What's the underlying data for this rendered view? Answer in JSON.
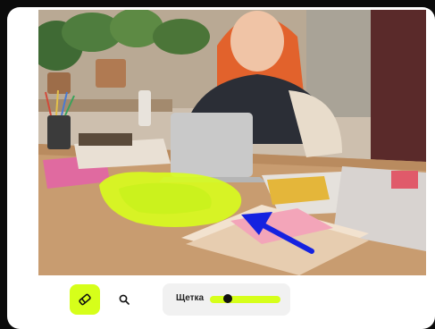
{
  "editor": {
    "image": {
      "alt": "",
      "mask_color": "#d8ff1a",
      "arrow_color": "#1522e0"
    },
    "toolbar": {
      "eraser_tool": {
        "icon": "eraser-icon",
        "active": true
      },
      "zoom_tool": {
        "icon": "search-icon"
      },
      "brush": {
        "label": "Щетка",
        "size_fraction": 0.25
      }
    },
    "accent": "#d6ff1a"
  }
}
